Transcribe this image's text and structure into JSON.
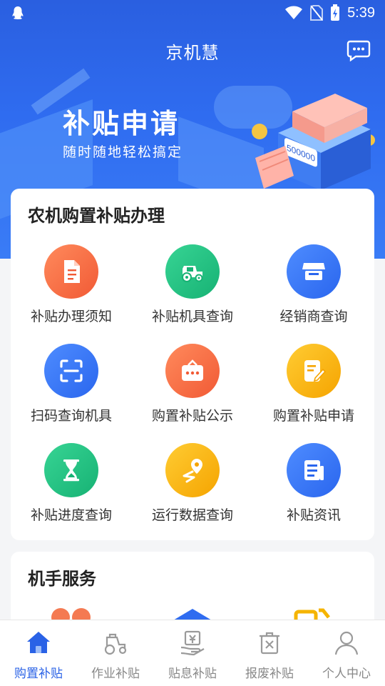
{
  "status_bar": {
    "time": "5:39"
  },
  "header": {
    "title": "京机慧"
  },
  "banner": {
    "title": "补贴申请",
    "subtitle": "随时随地轻松搞定",
    "machine_display": "500000"
  },
  "subsidy_card": {
    "title": "农机购置补贴办理",
    "items": [
      {
        "label": "补贴办理须知",
        "icon": "document-icon",
        "color": "#f4663e"
      },
      {
        "label": "补贴机具查询",
        "icon": "tractor-icon",
        "color": "#1fbf80"
      },
      {
        "label": "经销商查询",
        "icon": "store-icon",
        "color": "#3373f2"
      },
      {
        "label": "扫码查询机具",
        "icon": "scan-icon",
        "color": "#3373f2"
      },
      {
        "label": "购置补贴公示",
        "icon": "notice-board-icon",
        "color": "#f4663e"
      },
      {
        "label": "购置补贴申请",
        "icon": "edit-form-icon",
        "color": "#f8b215"
      },
      {
        "label": "补贴进度查询",
        "icon": "hourglass-icon",
        "color": "#1fbf80"
      },
      {
        "label": "运行数据查询",
        "icon": "location-route-icon",
        "color": "#f8b215"
      },
      {
        "label": "补贴资讯",
        "icon": "news-icon",
        "color": "#3373f2"
      }
    ]
  },
  "driver_card": {
    "title": "机手服务"
  },
  "tabbar": {
    "items": [
      {
        "label": "购置补贴",
        "icon": "home-icon",
        "active": true
      },
      {
        "label": "作业补贴",
        "icon": "tractor-outline-icon",
        "active": false
      },
      {
        "label": "贴息补贴",
        "icon": "yuan-hand-icon",
        "active": false
      },
      {
        "label": "报废补贴",
        "icon": "scrap-bin-icon",
        "active": false
      },
      {
        "label": "个人中心",
        "icon": "person-icon",
        "active": false
      }
    ]
  },
  "colors": {
    "primary": "#2f6cf0",
    "active_tab": "#2a62e6",
    "inactive_tab": "#888888"
  }
}
